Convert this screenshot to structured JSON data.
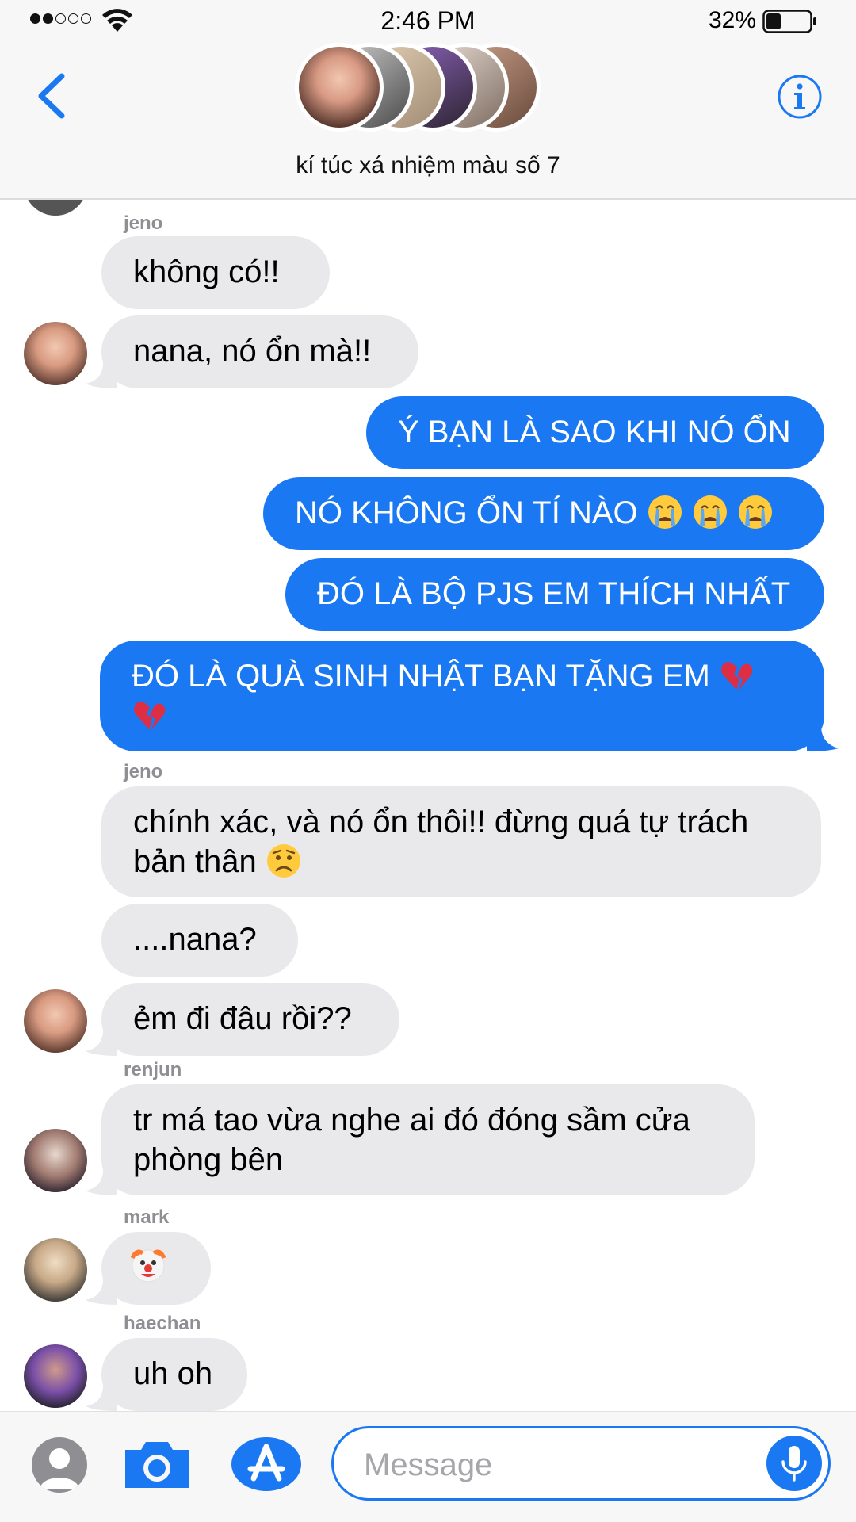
{
  "status_bar": {
    "time": "2:46 PM",
    "battery_percent": "32%",
    "battery_level": 0.32,
    "signal_bars_filled": 2,
    "signal_bars_total": 5
  },
  "header": {
    "group_name": "kí túc xá nhiệm màu số 7",
    "back_icon": "chevron-left-icon",
    "info_icon": "info-icon",
    "member_avatars": 6
  },
  "messages": [
    {
      "id": 1,
      "type": "in",
      "sender": "jeno",
      "text": "không có!!",
      "show_avatar": false
    },
    {
      "id": 2,
      "type": "in",
      "sender": "",
      "text": "nana, nó ổn mà!!",
      "show_avatar": true,
      "avatar": "jeno"
    },
    {
      "id": 3,
      "type": "out",
      "text": "Ý BẠN LÀ SAO KHI NÓ ỔN"
    },
    {
      "id": 4,
      "type": "out",
      "text": "NÓ KHÔNG ỔN TÍ NÀO",
      "emoji": [
        "crying-face",
        "crying-face",
        "crying-face"
      ]
    },
    {
      "id": 5,
      "type": "out",
      "text": "ĐÓ LÀ BỘ PJS EM THÍCH NHẤT"
    },
    {
      "id": 6,
      "type": "out",
      "text": "ĐÓ LÀ QUÀ SINH NHẬT BẠN TẶNG EM",
      "emoji": [
        "broken-heart",
        "broken-heart"
      ]
    },
    {
      "id": 7,
      "type": "in",
      "sender": "jeno",
      "text": "chính xác, và nó ổn thôi!! đừng quá tự trách bản thân",
      "emoji": [
        "worried-face"
      ],
      "show_avatar": false
    },
    {
      "id": 8,
      "type": "in",
      "sender": "",
      "text": "....nana?",
      "show_avatar": false
    },
    {
      "id": 9,
      "type": "in",
      "sender": "",
      "text": "ẻm đi đâu rồi??",
      "show_avatar": true,
      "avatar": "jeno"
    },
    {
      "id": 10,
      "type": "in",
      "sender": "renjun",
      "text": "tr má tao vừa nghe ai đó đóng sầm cửa phòng bên",
      "show_avatar": true,
      "avatar": "renjun"
    },
    {
      "id": 11,
      "type": "in",
      "sender": "mark",
      "text": "",
      "emoji": [
        "clown-face"
      ],
      "show_avatar": true,
      "avatar": "mark"
    },
    {
      "id": 12,
      "type": "in",
      "sender": "haechan",
      "text": "uh oh",
      "show_avatar": true,
      "avatar": "haechan"
    }
  ],
  "composer": {
    "placeholder": "Message",
    "value": "",
    "contact_icon": "contact-icon",
    "camera_icon": "camera-icon",
    "appstore_icon": "app-store-icon",
    "mic_icon": "microphone-icon"
  },
  "colors": {
    "accent": "#1a78f2",
    "incoming_bubble": "#e9e9eb",
    "header_bg": "#f7f7f8",
    "sender_label": "#8e8e93"
  }
}
